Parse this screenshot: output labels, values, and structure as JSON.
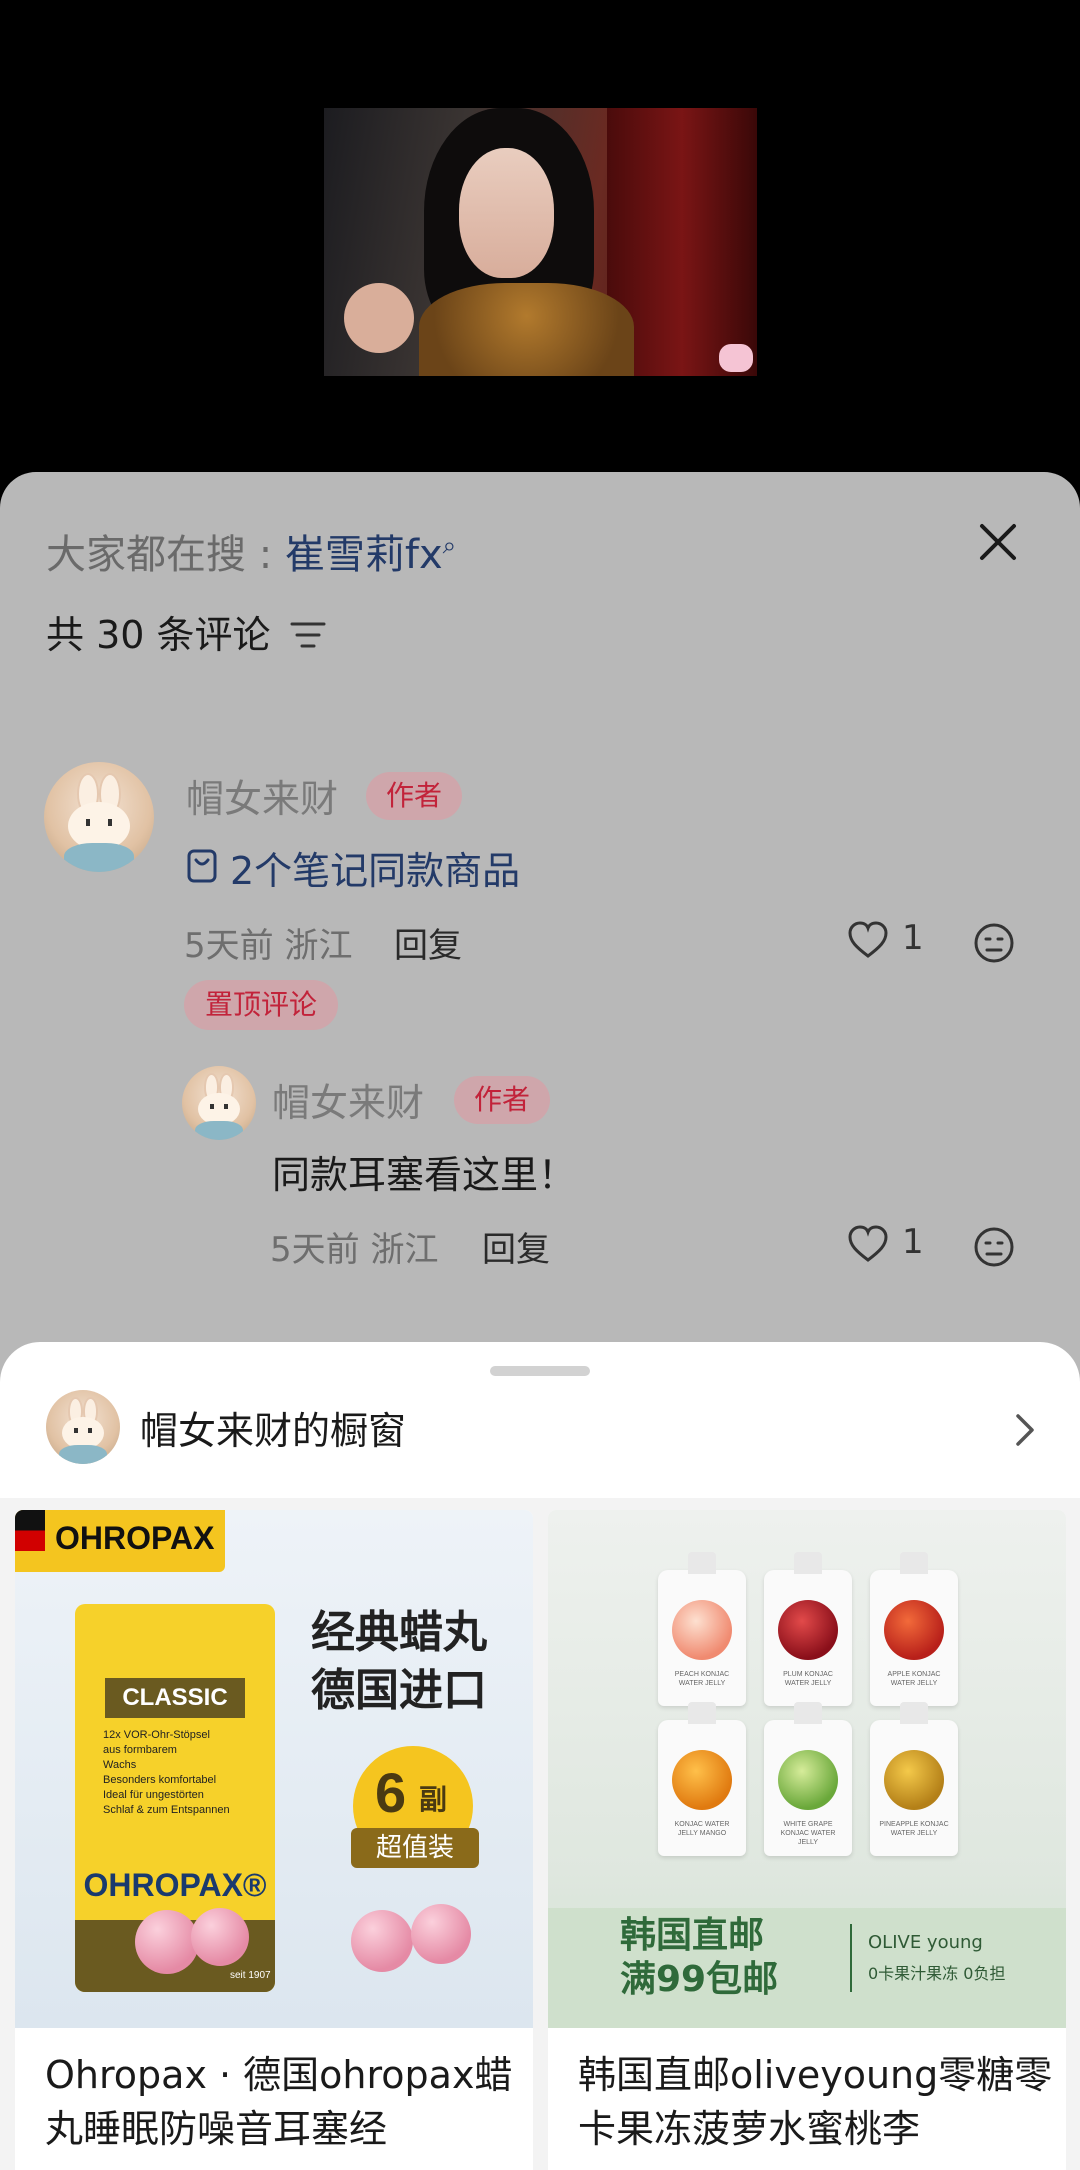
{
  "search": {
    "prefix": "大家都在搜 : ",
    "keyword": "崔雪莉fx",
    "search_glyph": "⌕"
  },
  "comments_header": {
    "count_label": "共 30 条评论"
  },
  "comments": [
    {
      "author": "帽女来财",
      "badge": "作者",
      "goods_link": "2个笔记同款商品",
      "time": "5天前",
      "location": "浙江",
      "reply_label": "回复",
      "likes": "1",
      "pinned": "置顶评论"
    }
  ],
  "replies": [
    {
      "author": "帽女来财",
      "badge": "作者",
      "text": "同款耳塞看这里！",
      "time": "5天前",
      "location": "浙江",
      "reply_label": "回复",
      "likes": "1"
    }
  ],
  "shop": {
    "title": "帽女来财的橱窗",
    "products": [
      {
        "title": "Ohropax · 德国ohropax蜡丸睡眠防噪音耳塞经",
        "image_text": {
          "brand_tag": "OHROPAX",
          "box_label": "CLASSIC",
          "box_lines": [
            "12x VOR-Ohr-Stöpsel",
            "aus formbarem",
            "Wachs",
            "Besonders komfortabel",
            "Ideal für ungestörten",
            "Schlaf & zum Entspannen"
          ],
          "box_brand": "OHROPAX®",
          "since": "seit 1907",
          "slogan_1": "经典蜡丸",
          "slogan_2": "德国进口",
          "count_num": "6",
          "count_unit": "副",
          "value_tag": "超值装"
        }
      },
      {
        "title": "韩国直邮oliveyoung零糖零卡果冻菠萝水蜜桃李",
        "image_text": {
          "headline_1": "韩国直邮",
          "headline_2": "满99包邮",
          "brand": "OLIVE    young",
          "sub": "0卡果汁果冻    0负担",
          "pouch_labels": [
            "PEACH KONJAC WATER JELLY",
            "PLUM KONJAC WATER JELLY",
            "APPLE KONJAC WATER JELLY",
            "KONJAC WATER JELLY MANGO",
            "WHITE GRAPE KONJAC WATER JELLY",
            "PINEAPPLE KONJAC WATER JELLY"
          ]
        }
      }
    ]
  },
  "colors": {
    "accent_link": "#233a68",
    "author_badge_text": "#c2233a",
    "dim_overlay": "#b8b8b8"
  }
}
